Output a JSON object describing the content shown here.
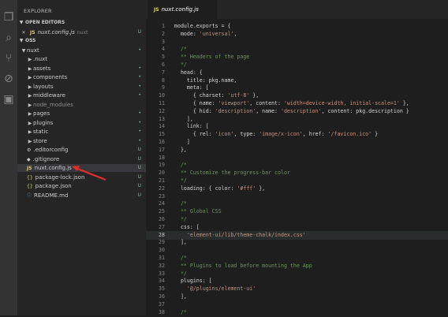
{
  "activity": {
    "icons": [
      "files-icon",
      "search-icon",
      "source-control-icon",
      "debug-icon",
      "extensions-icon"
    ]
  },
  "sidebar": {
    "title": "EXPLORER",
    "open_editors": {
      "header": "OPEN EDITORS",
      "file": {
        "badge": "JS",
        "name": "nuxt.config.js",
        "hint": "nuxt",
        "status": "U"
      }
    },
    "project": {
      "header": "OSS",
      "root": "nuxt",
      "items": [
        {
          "name": ".nuxt",
          "kind": "folder",
          "status": ""
        },
        {
          "name": "assets",
          "kind": "folder",
          "status": "•"
        },
        {
          "name": "components",
          "kind": "folder",
          "status": "•"
        },
        {
          "name": "layouts",
          "kind": "folder",
          "status": "•"
        },
        {
          "name": "middleware",
          "kind": "folder",
          "status": "•"
        },
        {
          "name": "node_modules",
          "kind": "folder",
          "status": ""
        },
        {
          "name": "pages",
          "kind": "folder",
          "status": "•"
        },
        {
          "name": "plugins",
          "kind": "folder",
          "status": "•"
        },
        {
          "name": "static",
          "kind": "folder",
          "status": "•"
        },
        {
          "name": "store",
          "kind": "folder",
          "status": "•"
        },
        {
          "name": ".editorconfig",
          "kind": "config",
          "badge": "⚙",
          "status": "U"
        },
        {
          "name": ".gitignore",
          "kind": "git",
          "badge": "◆",
          "status": "U"
        },
        {
          "name": "nuxt.config.js",
          "kind": "js",
          "badge": "JS",
          "status": "U"
        },
        {
          "name": "package-lock.json",
          "kind": "json",
          "badge": "{}",
          "status": "U"
        },
        {
          "name": "package.json",
          "kind": "json",
          "badge": "{}",
          "status": "U"
        },
        {
          "name": "README.md",
          "kind": "md",
          "badge": "ⓘ",
          "status": "U"
        }
      ]
    }
  },
  "tab": {
    "badge": "JS",
    "name": "nuxt.config.js"
  },
  "code_lines": [
    {
      "n": "1",
      "tokens": [
        [
          "t-plain",
          "module.exports = {"
        ]
      ]
    },
    {
      "n": "2",
      "tokens": [
        [
          "t-plain",
          "  mode: "
        ],
        [
          "t-str",
          "'universal'"
        ],
        [
          "t-plain",
          ","
        ]
      ]
    },
    {
      "n": "3",
      "tokens": []
    },
    {
      "n": "4",
      "tokens": [
        [
          "t-com",
          "  /*"
        ]
      ]
    },
    {
      "n": "5",
      "tokens": [
        [
          "t-com",
          "  ** Headers of the page"
        ]
      ]
    },
    {
      "n": "6",
      "tokens": [
        [
          "t-com",
          "  */"
        ]
      ]
    },
    {
      "n": "7",
      "tokens": [
        [
          "t-plain",
          "  head: {"
        ]
      ]
    },
    {
      "n": "8",
      "tokens": [
        [
          "t-plain",
          "    title: pkg.name,"
        ]
      ]
    },
    {
      "n": "9",
      "tokens": [
        [
          "t-plain",
          "    meta: ["
        ]
      ]
    },
    {
      "n": "10",
      "tokens": [
        [
          "t-plain",
          "      { charset: "
        ],
        [
          "t-str",
          "'utf-8'"
        ],
        [
          "t-plain",
          " },"
        ]
      ]
    },
    {
      "n": "11",
      "tokens": [
        [
          "t-plain",
          "      { name: "
        ],
        [
          "t-str",
          "'viewport'"
        ],
        [
          "t-plain",
          ", content: "
        ],
        [
          "t-str",
          "'width=device-width, initial-scale=1'"
        ],
        [
          "t-plain",
          " },"
        ]
      ]
    },
    {
      "n": "12",
      "tokens": [
        [
          "t-plain",
          "      { hid: "
        ],
        [
          "t-str",
          "'description'"
        ],
        [
          "t-plain",
          ", name: "
        ],
        [
          "t-str",
          "'description'"
        ],
        [
          "t-plain",
          ", content: pkg.description }"
        ]
      ]
    },
    {
      "n": "13",
      "tokens": [
        [
          "t-plain",
          "    ],"
        ]
      ]
    },
    {
      "n": "14",
      "tokens": [
        [
          "t-plain",
          "    link: ["
        ]
      ]
    },
    {
      "n": "15",
      "tokens": [
        [
          "t-plain",
          "      { rel: "
        ],
        [
          "t-str",
          "'icon'"
        ],
        [
          "t-plain",
          ", type: "
        ],
        [
          "t-str",
          "'image/x-icon'"
        ],
        [
          "t-plain",
          ", href: "
        ],
        [
          "t-str",
          "'/favicon.ico'"
        ],
        [
          "t-plain",
          " }"
        ]
      ]
    },
    {
      "n": "16",
      "tokens": [
        [
          "t-plain",
          "    ]"
        ]
      ]
    },
    {
      "n": "17",
      "tokens": [
        [
          "t-plain",
          "  },"
        ]
      ]
    },
    {
      "n": "18",
      "tokens": []
    },
    {
      "n": "19",
      "tokens": [
        [
          "t-com",
          "  /*"
        ]
      ]
    },
    {
      "n": "20",
      "tokens": [
        [
          "t-com",
          "  ** Customize the progress-bar color"
        ]
      ]
    },
    {
      "n": "21",
      "tokens": [
        [
          "t-com",
          "  */"
        ]
      ]
    },
    {
      "n": "22",
      "tokens": [
        [
          "t-plain",
          "  loading: { color: "
        ],
        [
          "t-str",
          "'#fff'"
        ],
        [
          "t-plain",
          " },"
        ]
      ]
    },
    {
      "n": "23",
      "tokens": []
    },
    {
      "n": "24",
      "tokens": [
        [
          "t-com",
          "  /*"
        ]
      ]
    },
    {
      "n": "25",
      "tokens": [
        [
          "t-com",
          "  ** Global CSS"
        ]
      ]
    },
    {
      "n": "26",
      "tokens": [
        [
          "t-com",
          "  */"
        ]
      ]
    },
    {
      "n": "27",
      "tokens": [
        [
          "t-plain",
          "  css: ["
        ]
      ]
    },
    {
      "n": "28",
      "tokens": [
        [
          "t-str",
          "    'element-ui/lib/theme-chalk/index.css'"
        ]
      ]
    },
    {
      "n": "29",
      "tokens": [
        [
          "t-plain",
          "  ],"
        ]
      ]
    },
    {
      "n": "30",
      "tokens": []
    },
    {
      "n": "31",
      "tokens": [
        [
          "t-com",
          "  /*"
        ]
      ]
    },
    {
      "n": "32",
      "tokens": [
        [
          "t-com",
          "  ** Plugins to load before mounting the App"
        ]
      ]
    },
    {
      "n": "33",
      "tokens": [
        [
          "t-com",
          "  */"
        ]
      ]
    },
    {
      "n": "34",
      "tokens": [
        [
          "t-plain",
          "  plugins: ["
        ]
      ]
    },
    {
      "n": "35",
      "tokens": [
        [
          "t-str",
          "    '@/plugins/element-ui'"
        ]
      ]
    },
    {
      "n": "36",
      "tokens": [
        [
          "t-plain",
          "  ],"
        ]
      ]
    },
    {
      "n": "37",
      "tokens": []
    },
    {
      "n": "38",
      "tokens": [
        [
          "t-com",
          "  /*"
        ]
      ]
    }
  ],
  "active_line": "28"
}
